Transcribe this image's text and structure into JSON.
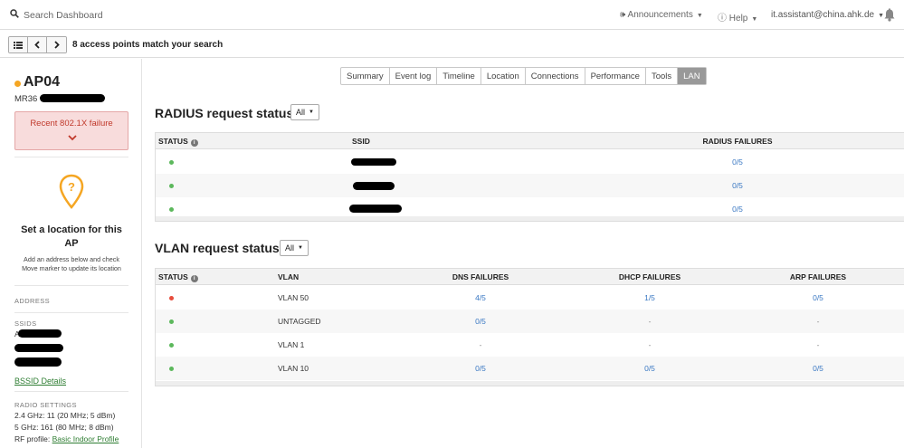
{
  "topbar": {
    "search_placeholder": "Search Dashboard",
    "announcements": "Announcements",
    "help": "Help",
    "user": "it.assistant@china.ahk.de"
  },
  "subbar": {
    "match_text": "8 access points match your search"
  },
  "sidebar": {
    "ap_name": "AP04",
    "ap_model": "MR36",
    "status_color": "#f5a623",
    "alert_text": "Recent 802.1X failure",
    "location_title": "Set a location for this AP",
    "location_desc_1": "Add an address below and check",
    "location_desc_2": "Move marker to update its location",
    "address_label": "ADDRESS",
    "ssids_label": "SSIDS",
    "ssid_first_letter": "A",
    "bssid_link": "BSSID Details",
    "radio_label": "RADIO SETTINGS",
    "radio_24": "2.4 GHz: 11 (20 MHz; 5 dBm)",
    "radio_5": "5 GHz: 161 (80 MHz; 8 dBm)",
    "rf_profile_label": "RF profile:",
    "rf_profile_link": "Basic Indoor Profile"
  },
  "tabs": [
    {
      "label": "Summary",
      "active": false
    },
    {
      "label": "Event log",
      "active": false
    },
    {
      "label": "Timeline",
      "active": false
    },
    {
      "label": "Location",
      "active": false
    },
    {
      "label": "Connections",
      "active": false
    },
    {
      "label": "Performance",
      "active": false
    },
    {
      "label": "Tools",
      "active": false
    },
    {
      "label": "LAN",
      "active": true
    }
  ],
  "radius": {
    "title": "RADIUS request status:",
    "filter": "All",
    "headers": {
      "status": "STATUS",
      "ssid": "SSID",
      "failures": "RADIUS FAILURES"
    },
    "rows": [
      {
        "status": "ok",
        "failures": "0/5"
      },
      {
        "status": "ok",
        "failures": "0/5"
      },
      {
        "status": "ok",
        "failures": "0/5"
      }
    ]
  },
  "vlan": {
    "title": "VLAN request status:",
    "filter": "All",
    "headers": {
      "status": "STATUS",
      "vlan": "VLAN",
      "dns": "DNS FAILURES",
      "dhcp": "DHCP FAILURES",
      "arp": "ARP FAILURES"
    },
    "rows": [
      {
        "status": "fail",
        "vlan": "VLAN 50",
        "dns": "4/5",
        "dhcp": "1/5",
        "arp": "0/5"
      },
      {
        "status": "ok",
        "vlan": "UNTAGGED",
        "dns": "0/5",
        "dhcp": "-",
        "arp": "-"
      },
      {
        "status": "ok",
        "vlan": "VLAN 1",
        "dns": "-",
        "dhcp": "-",
        "arp": "-"
      },
      {
        "status": "ok",
        "vlan": "VLAN 10",
        "dns": "0/5",
        "dhcp": "0/5",
        "arp": "0/5"
      }
    ]
  },
  "colors": {
    "ok": "#5cb85c",
    "fail": "#e74c3c",
    "link": "#3a78c3",
    "warning": "#f5a623"
  }
}
